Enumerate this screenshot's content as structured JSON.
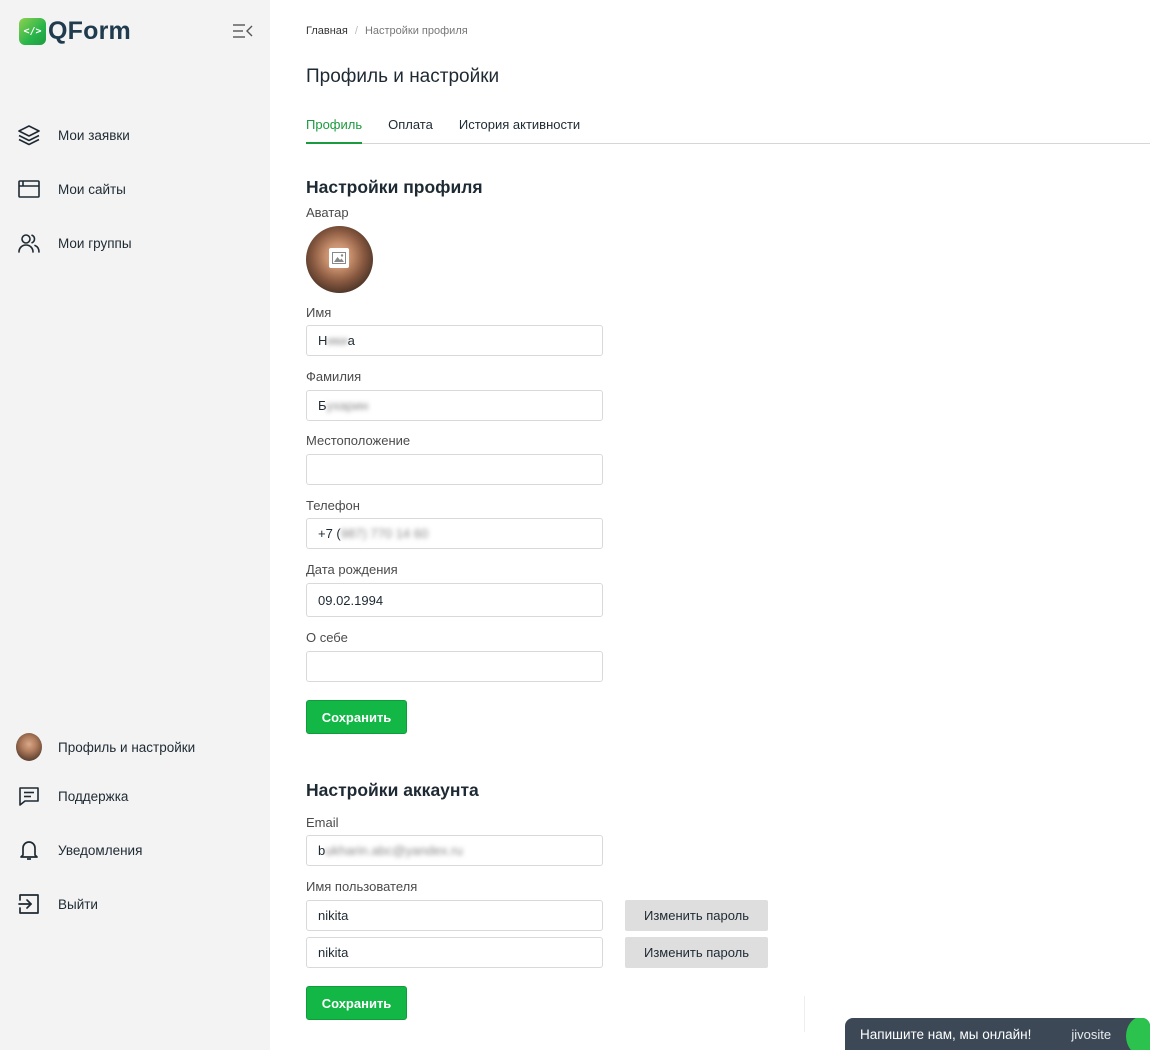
{
  "app": {
    "logo_text": "QForm",
    "logo_mark": "</>"
  },
  "sidebar": {
    "top_items": [
      {
        "label": "Мои заявки",
        "icon": "layers-icon"
      },
      {
        "label": "Мои сайты",
        "icon": "browser-window-icon"
      },
      {
        "label": "Мои группы",
        "icon": "users-icon"
      }
    ],
    "bottom_items": [
      {
        "label": "Профиль и настройки",
        "icon": "avatar"
      },
      {
        "label": "Поддержка",
        "icon": "message-icon"
      },
      {
        "label": "Уведомления",
        "icon": "bell-icon"
      },
      {
        "label": "Выйти",
        "icon": "logout-icon"
      }
    ]
  },
  "breadcrumb": {
    "home": "Главная",
    "separator": "/",
    "current": "Настройки профиля"
  },
  "page_title": "Профиль и настройки",
  "tabs": [
    {
      "label": "Профиль",
      "active": true
    },
    {
      "label": "Оплата",
      "active": false
    },
    {
      "label": "История активности",
      "active": false
    }
  ],
  "profile_settings": {
    "title": "Настройки профиля",
    "avatar_label": "Аватар",
    "first_name": {
      "label": "Имя",
      "value_visible": "Н",
      "value_blurred": "ики",
      "value_tail": "а"
    },
    "last_name": {
      "label": "Фамилия",
      "value_visible": "Б",
      "value_blurred": "ухарин"
    },
    "location": {
      "label": "Местоположение",
      "value": ""
    },
    "phone": {
      "label": "Телефон",
      "value_visible": "+7 (",
      "value_blurred": "987) 770 14 60"
    },
    "birth_date": {
      "label": "Дата рождения",
      "value": "09.02.1994"
    },
    "about": {
      "label": "О себе",
      "value": ""
    },
    "save_label": "Сохранить"
  },
  "account_settings": {
    "title": "Настройки аккаунта",
    "email": {
      "label": "Email",
      "value_visible": "b",
      "value_blurred": "ukharin.abc@yandex.ru"
    },
    "username": {
      "label": "Имя пользователя",
      "value": "nikita"
    },
    "username_second": {
      "value": "nikita"
    },
    "change_password_label": "Изменить пароль",
    "save_label": "Сохранить"
  },
  "chat": {
    "text": "Напишите нам, мы онлайн!",
    "brand": "jivosite"
  },
  "colors": {
    "accent": "#1a9b3f",
    "button_green": "#12b746",
    "sidebar_bg": "#f3f3f3",
    "chat_bg": "#3c4856"
  }
}
